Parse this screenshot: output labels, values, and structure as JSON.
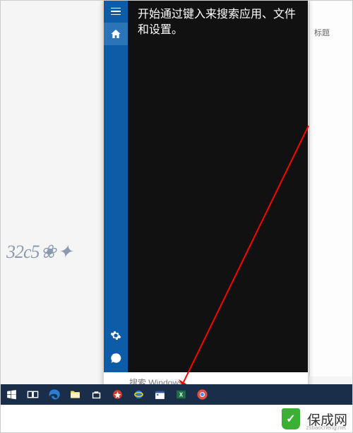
{
  "flyout": {
    "hint": "开始通过键入来搜索应用、文件和设置。"
  },
  "search": {
    "placeholder": "搜索 Windows"
  },
  "right_panel": {
    "tab_label": "标题"
  },
  "footer": {
    "brand": "保成网",
    "url": "zsbaocheng.net"
  },
  "colors": {
    "accent": "#0d5ca8",
    "taskbar": "#1a2e4a",
    "arrow": "#ff0000",
    "badge": "#3cb034"
  }
}
